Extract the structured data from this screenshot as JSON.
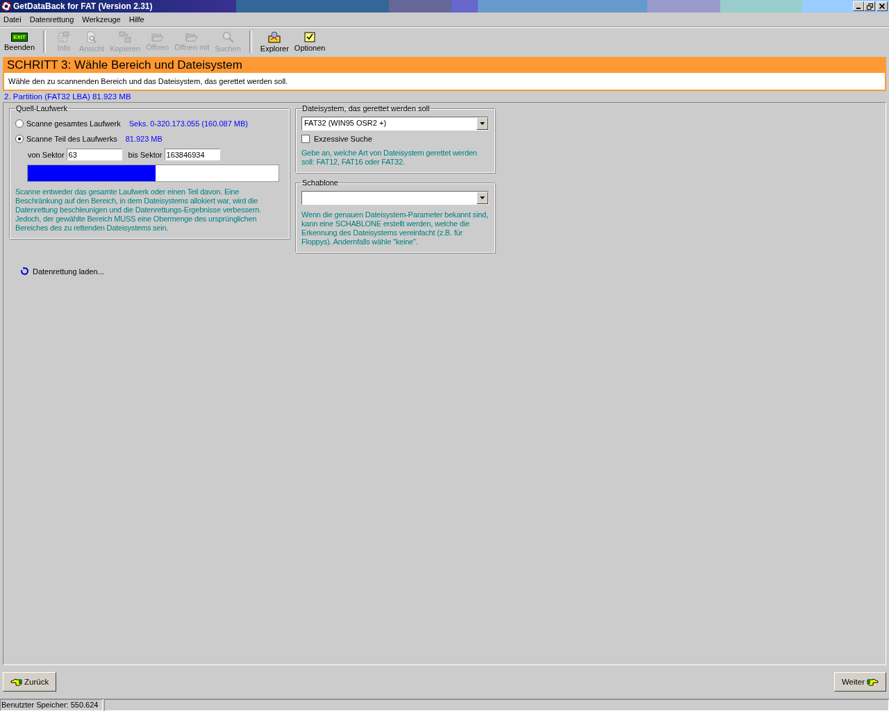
{
  "window": {
    "title": "GetDataBack for FAT (Version 2.31)"
  },
  "menu": [
    "Datei",
    "Datenrettung",
    "Werkzeuge",
    "Hilfe"
  ],
  "toolbar": [
    {
      "kind": "exit",
      "badge": "EXIT",
      "label": "Beenden",
      "disabled": false
    },
    {
      "kind": "info",
      "label": "Info",
      "disabled": true
    },
    {
      "kind": "view",
      "label": "Ansicht",
      "disabled": true
    },
    {
      "kind": "copy",
      "label": "Kopieren",
      "disabled": true
    },
    {
      "kind": "open",
      "label": "Öffnen",
      "disabled": true
    },
    {
      "kind": "openwith",
      "label": "Öffnen mit",
      "disabled": true
    },
    {
      "kind": "search",
      "label": "Suchen",
      "disabled": true
    },
    {
      "kind": "explorer",
      "label": "Explorer",
      "disabled": false
    },
    {
      "kind": "options",
      "label": "Optionen",
      "disabled": false
    }
  ],
  "step": {
    "title": "SCHRITT 3: Wähle Bereich und Dateisystem",
    "description": "Wähle den zu scannenden Bereich und das Dateisystem, das gerettet werden soll."
  },
  "partition": "2. Partition (FAT32 LBA) 81.923 MB",
  "source_group": {
    "legend": "Quell-Laufwerk",
    "options": [
      {
        "label": "Scanne gesamtes Laufwerk",
        "info": "Seks. 0-320.173.055 (160.087 MB)",
        "selected": false
      },
      {
        "label": "Scanne Teil des Laufwerks",
        "info": "81.923 MB",
        "selected": true
      }
    ],
    "from_label": "von Sektor",
    "from_value": "63",
    "to_label": "bis Sektor",
    "to_value": "163846934",
    "range": {
      "level": 0.51
    },
    "help": "Scanne entweder das gesamte Laufwerk oder einen Teil davon. Eine Beschränkung auf den Bereich, in dem Dateisystems allokiert war, wird die Datenrettung beschleunigen und die Datenrettungs-Ergebnisse verbessern. Jedoch, der gewählte Bereich MUSS eine Obermenge des ursprünglichen Bereiches des zu rettenden Dateisystems sein."
  },
  "filesystem_group": {
    "legend": "Dateisystem, das gerettet werden soll",
    "value": "FAT32 (WIN95 OSR2 +)",
    "checkbox": {
      "label": "Exzessive Suche",
      "checked": false
    },
    "help": "Gebe an, welche Art von Dateisystem gerettet werden soll: FAT12, FAT16 oder FAT32."
  },
  "template_group": {
    "legend": "Schablone",
    "help": "Wenn die genauen Dateisystem-Parameter bekannt sind, kann eine SCHABLONE erstellt werden, welche die Erkennung des Dateisystems vereinfacht (z.B. für Floppys). Andernfalls wähle \"keine\"."
  },
  "loading": "Datenrettung laden...",
  "back_button": "Zurück",
  "next_button": "Weiter",
  "status_bar": [
    "Benutzter Speicher: 550.624"
  ]
}
